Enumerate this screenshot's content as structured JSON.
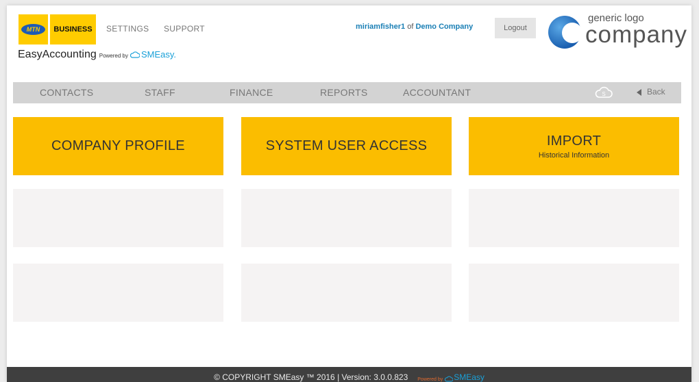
{
  "header": {
    "mtn_logo_text": "MTN",
    "business_logo_text": "BUSINESS",
    "top_nav": [
      "SETTINGS",
      "SUPPORT"
    ],
    "brand_name": "EasyAccounting",
    "powered_by": "Powered by",
    "powered_brand": "SMEasy.",
    "user": {
      "username": "miriamfisher1",
      "of": "of",
      "company": "Demo Company"
    },
    "logout_label": "Logout",
    "company_logo_small": "generic logo",
    "company_logo_big": "company",
    "accent_color": "#ffcc00",
    "link_color": "#1a7fb5"
  },
  "nav": {
    "items": [
      "CONTACTS",
      "STAFF",
      "FINANCE",
      "REPORTS",
      "ACCOUNTANT"
    ],
    "cloud_icon": "cloud-s-icon",
    "back_label": "Back"
  },
  "tiles": [
    {
      "title": "COMPANY PROFILE",
      "subtitle": ""
    },
    {
      "title": "SYSTEM USER ACCESS",
      "subtitle": ""
    },
    {
      "title": "IMPORT",
      "subtitle": "Historical Information"
    }
  ],
  "tile_color": "#fbbd00",
  "footer": {
    "copyright": "© COPYRIGHT SMEasy ™ 2016 | Version: 3.0.0.823",
    "powered_by": "Powered by",
    "powered_brand": "SMEasy"
  }
}
